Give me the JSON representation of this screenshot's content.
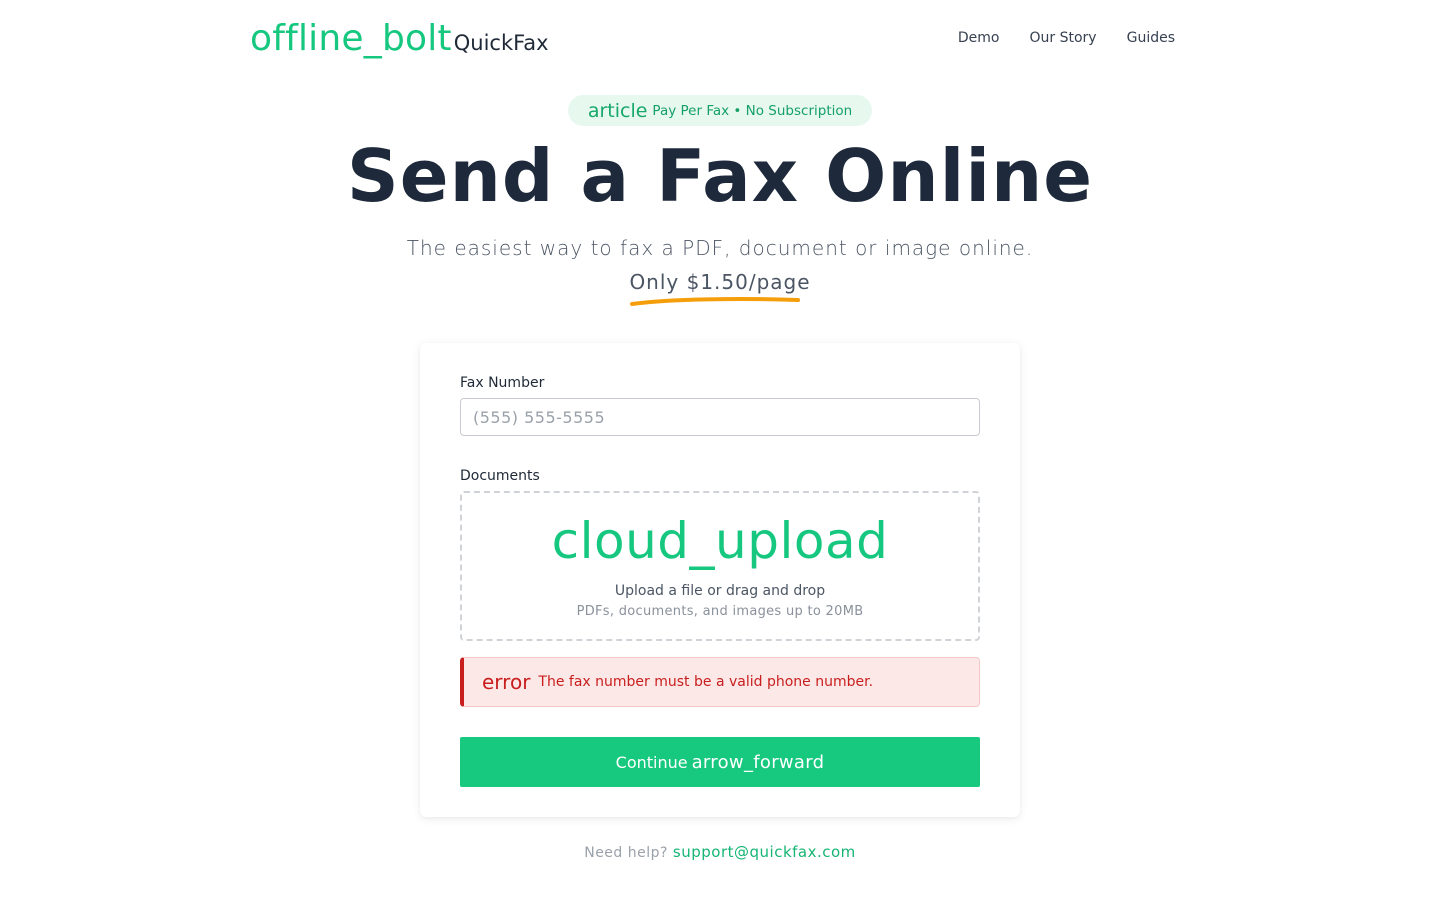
{
  "header": {
    "logo_icon": "offline_bolt",
    "brand": "QuickFax",
    "nav": [
      "Demo",
      "Our Story",
      "Guides"
    ]
  },
  "hero": {
    "badge_icon": "article",
    "badge_text": "Pay Per Fax • No Subscription",
    "title": "Send a Fax Online",
    "subtitle": "The easiest way to fax a PDF, document or image online.",
    "price": "Only $1.50/page"
  },
  "form": {
    "fax_label": "Fax Number",
    "fax_placeholder": "(555) 555-5555",
    "fax_value": "",
    "docs_label": "Documents",
    "upload_icon": "cloud_upload",
    "upload_main": "Upload a file or drag and drop",
    "upload_sub": "PDFs, documents, and images up to 20MB",
    "error_icon": "error",
    "error_text": "The fax number must be a valid phone number.",
    "continue_label": "Continue",
    "continue_icon": "arrow_forward"
  },
  "footer": {
    "help_text": "Need help?",
    "help_email": "support@quickfax.com"
  },
  "colors": {
    "accent": "#16c97f",
    "error": "#c81e1e",
    "underline": "#f59e0b"
  }
}
